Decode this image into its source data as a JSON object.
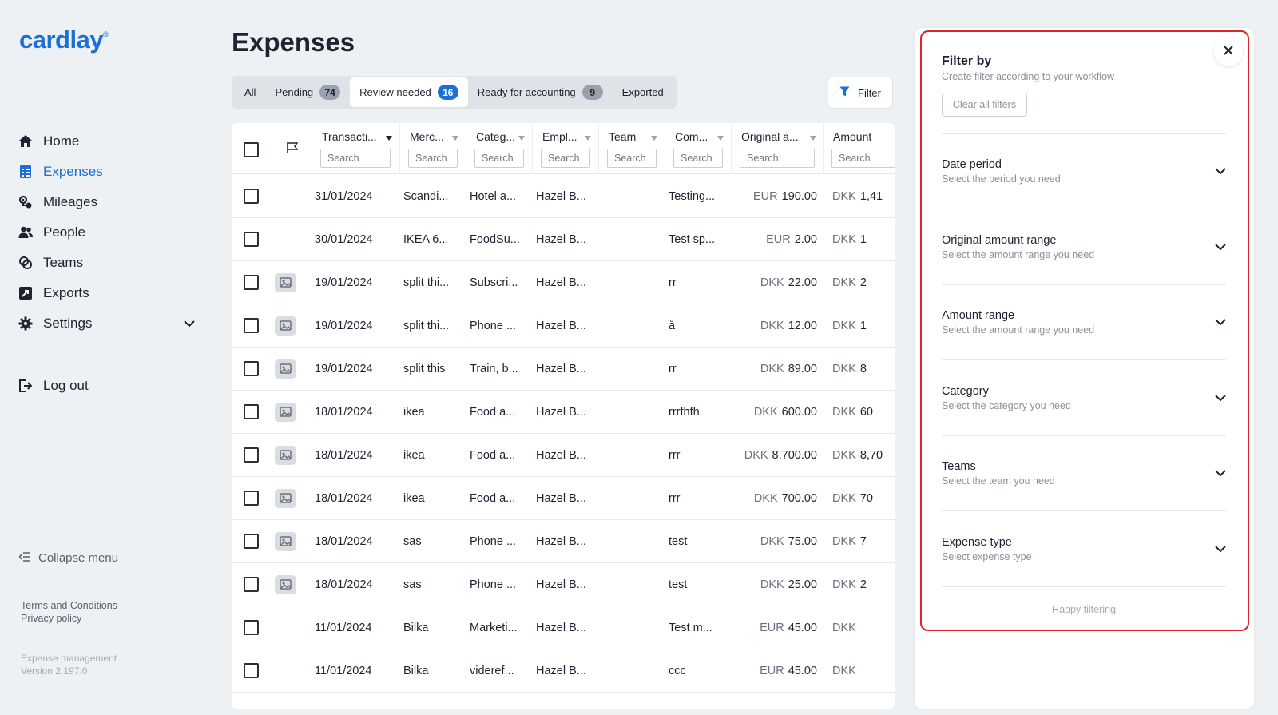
{
  "brand": {
    "name": "cardlay",
    "mark": "®"
  },
  "sidebar": {
    "items": [
      {
        "label": "Home",
        "icon": "home-icon"
      },
      {
        "label": "Expenses",
        "icon": "expenses-icon",
        "active": true
      },
      {
        "label": "Mileages",
        "icon": "mileages-icon"
      },
      {
        "label": "People",
        "icon": "people-icon"
      },
      {
        "label": "Teams",
        "icon": "teams-icon"
      },
      {
        "label": "Exports",
        "icon": "exports-icon"
      },
      {
        "label": "Settings",
        "icon": "gear-icon"
      }
    ],
    "logout_label": "Log out",
    "collapse_label": "Collapse menu",
    "terms_label": "Terms and Conditions",
    "privacy_label": "Privacy policy",
    "product_label": "Expense management",
    "version_label": "Version 2.197.0"
  },
  "page": {
    "title": "Expenses"
  },
  "tabs": [
    {
      "label": "All",
      "count": null
    },
    {
      "label": "Pending",
      "count": "74"
    },
    {
      "label": "Review needed",
      "count": "16",
      "active": true
    },
    {
      "label": "Ready for accounting",
      "count": "9"
    },
    {
      "label": "Exported",
      "count": null
    }
  ],
  "filter_button_label": "Filter",
  "table": {
    "search_placeholder": "Search",
    "columns": [
      "Transacti...",
      "Merc...",
      "Categ...",
      "Empl...",
      "Team",
      "Com...",
      "Original a...",
      "Amount"
    ],
    "rows": [
      {
        "date": "31/01/2024",
        "merchant": "Scandi...",
        "category": "Hotel a...",
        "employee": "Hazel B...",
        "team": "",
        "comment": "Testing...",
        "orig_cur": "EUR",
        "orig_val": "190.00",
        "amt_cur": "DKK",
        "amt_val": "1,41",
        "receipt": false
      },
      {
        "date": "30/01/2024",
        "merchant": "IKEA 6...",
        "category": "FoodSu...",
        "employee": "Hazel B...",
        "team": "",
        "comment": "Test sp...",
        "orig_cur": "EUR",
        "orig_val": "2.00",
        "amt_cur": "DKK",
        "amt_val": "1",
        "receipt": false
      },
      {
        "date": "19/01/2024",
        "merchant": "split thi...",
        "category": "Subscri...",
        "employee": "Hazel B...",
        "team": "",
        "comment": "rr",
        "orig_cur": "DKK",
        "orig_val": "22.00",
        "amt_cur": "DKK",
        "amt_val": "2",
        "receipt": true
      },
      {
        "date": "19/01/2024",
        "merchant": "split thi...",
        "category": "Phone ...",
        "employee": "Hazel B...",
        "team": "",
        "comment": "å",
        "orig_cur": "DKK",
        "orig_val": "12.00",
        "amt_cur": "DKK",
        "amt_val": "1",
        "receipt": true
      },
      {
        "date": "19/01/2024",
        "merchant": "split this",
        "category": "Train, b...",
        "employee": "Hazel B...",
        "team": "",
        "comment": "rr",
        "orig_cur": "DKK",
        "orig_val": "89.00",
        "amt_cur": "DKK",
        "amt_val": "8",
        "receipt": true
      },
      {
        "date": "18/01/2024",
        "merchant": "ikea",
        "category": "Food a...",
        "employee": "Hazel B...",
        "team": "",
        "comment": "rrrfhfh",
        "orig_cur": "DKK",
        "orig_val": "600.00",
        "amt_cur": "DKK",
        "amt_val": "60",
        "receipt": true
      },
      {
        "date": "18/01/2024",
        "merchant": "ikea",
        "category": "Food a...",
        "employee": "Hazel B...",
        "team": "",
        "comment": "rrr",
        "orig_cur": "DKK",
        "orig_val": "8,700.00",
        "amt_cur": "DKK",
        "amt_val": "8,70",
        "receipt": true
      },
      {
        "date": "18/01/2024",
        "merchant": "ikea",
        "category": "Food a...",
        "employee": "Hazel B...",
        "team": "",
        "comment": "rrr",
        "orig_cur": "DKK",
        "orig_val": "700.00",
        "amt_cur": "DKK",
        "amt_val": "70",
        "receipt": true
      },
      {
        "date": "18/01/2024",
        "merchant": "sas",
        "category": "Phone ...",
        "employee": "Hazel B...",
        "team": "",
        "comment": "test",
        "orig_cur": "DKK",
        "orig_val": "75.00",
        "amt_cur": "DKK",
        "amt_val": "7",
        "receipt": true
      },
      {
        "date": "18/01/2024",
        "merchant": "sas",
        "category": "Phone ...",
        "employee": "Hazel B...",
        "team": "",
        "comment": "test",
        "orig_cur": "DKK",
        "orig_val": "25.00",
        "amt_cur": "DKK",
        "amt_val": "2",
        "receipt": true
      },
      {
        "date": "11/01/2024",
        "merchant": "Bilka",
        "category": "Marketi...",
        "employee": "Hazel B...",
        "team": "",
        "comment": "Test m...",
        "orig_cur": "EUR",
        "orig_val": "45.00",
        "amt_cur": "DKK",
        "amt_val": "",
        "receipt": false
      },
      {
        "date": "11/01/2024",
        "merchant": "Bilka",
        "category": "videref...",
        "employee": "Hazel B...",
        "team": "",
        "comment": "ccc",
        "orig_cur": "EUR",
        "orig_val": "45.00",
        "amt_cur": "DKK",
        "amt_val": "",
        "receipt": false
      }
    ]
  },
  "filter_panel": {
    "title": "Filter by",
    "subtitle": "Create filter according to your workflow",
    "clear_label": "Clear all filters",
    "sections": [
      {
        "title": "Date period",
        "subtitle": "Select the period you need"
      },
      {
        "title": "Original amount range",
        "subtitle": "Select the amount range you need"
      },
      {
        "title": "Amount range",
        "subtitle": "Select the amount range you need"
      },
      {
        "title": "Category",
        "subtitle": "Select the category you need"
      },
      {
        "title": "Teams",
        "subtitle": "Select the team you need"
      },
      {
        "title": "Expense type",
        "subtitle": "Select expense type"
      }
    ],
    "footer": "Happy filtering"
  },
  "colors": {
    "accent": "#1b6fd6",
    "highlight": "#dc2626",
    "background": "#eef1f4"
  }
}
